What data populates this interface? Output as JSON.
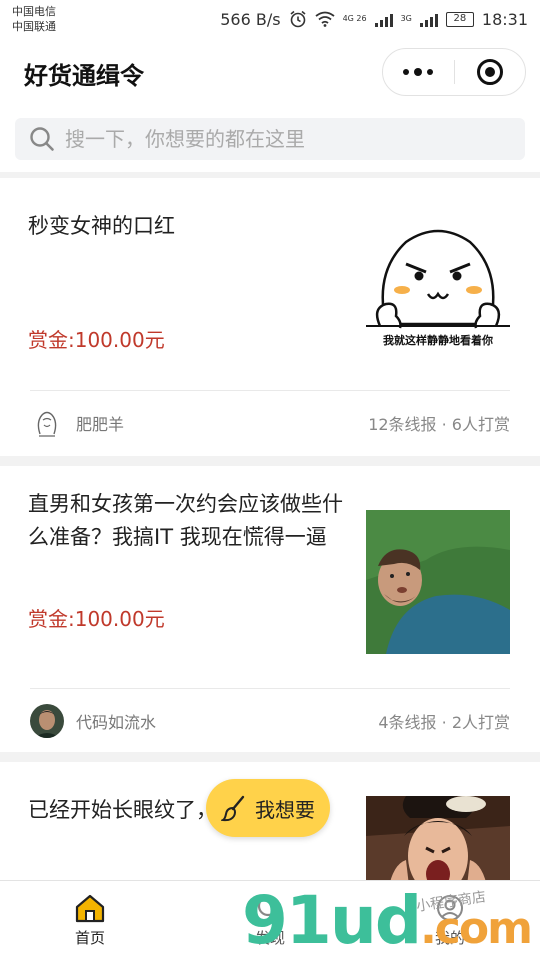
{
  "status_bar": {
    "carrier_1": "中国电信",
    "carrier_2": "中国联通",
    "speed": "566 B/s",
    "net_1": "4G 26",
    "net_2": "3G",
    "battery": "28",
    "time": "18:31"
  },
  "header": {
    "title": "好货通缉令"
  },
  "search": {
    "placeholder": "搜一下，你想要的都在这里"
  },
  "posts": [
    {
      "title": "秒变女神的口红",
      "reward": "赏金:100.00元",
      "thumb_caption": "我就这样静静地看着你",
      "author": "肥肥羊",
      "stats": "12条线报 · 6人打赏"
    },
    {
      "title": "直男和女孩第一次约会应该做些什么准备？我搞IT 我现在慌得一逼",
      "reward": "赏金:100.00元",
      "author": "代码如流水",
      "stats": "4条线报 · 2人打赏"
    },
    {
      "title": "已经开始长眼纹了，怎么办？"
    }
  ],
  "fab": {
    "label": "我想要"
  },
  "tabs": [
    {
      "label": "首页",
      "icon": "home-icon",
      "active": true
    },
    {
      "label": "发现",
      "icon": "discover-icon",
      "active": false
    },
    {
      "label": "我的",
      "icon": "profile-icon",
      "active": false
    }
  ],
  "watermark": {
    "text": "91ud",
    "domain": ".com",
    "script": "小程序商店"
  },
  "colors": {
    "accent": "#ffd24a",
    "reward": "#c0392b",
    "home_icon": "#f4b400"
  }
}
